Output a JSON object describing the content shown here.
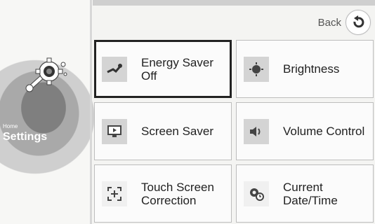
{
  "sidebar": {
    "home_label": "Home",
    "title": "Settings",
    "logo_icon": "settings-wrench-gear-icon"
  },
  "header": {
    "back_label": "Back",
    "back_icon": "undo-arrow-icon"
  },
  "tiles": [
    {
      "label": "Energy Saver Off",
      "icon": "plug-energy-icon",
      "selected": true
    },
    {
      "label": "Brightness",
      "icon": "brightness-icon",
      "selected": false
    },
    {
      "label": "Screen Saver",
      "icon": "monitor-icon",
      "selected": false
    },
    {
      "label": "Volume Control",
      "icon": "speaker-icon",
      "selected": false
    },
    {
      "label": "Touch Screen Correction",
      "icon": "touch-calibrate-icon",
      "selected": false
    },
    {
      "label": "Current Date/Time",
      "icon": "clock-gear-icon",
      "selected": false
    }
  ]
}
